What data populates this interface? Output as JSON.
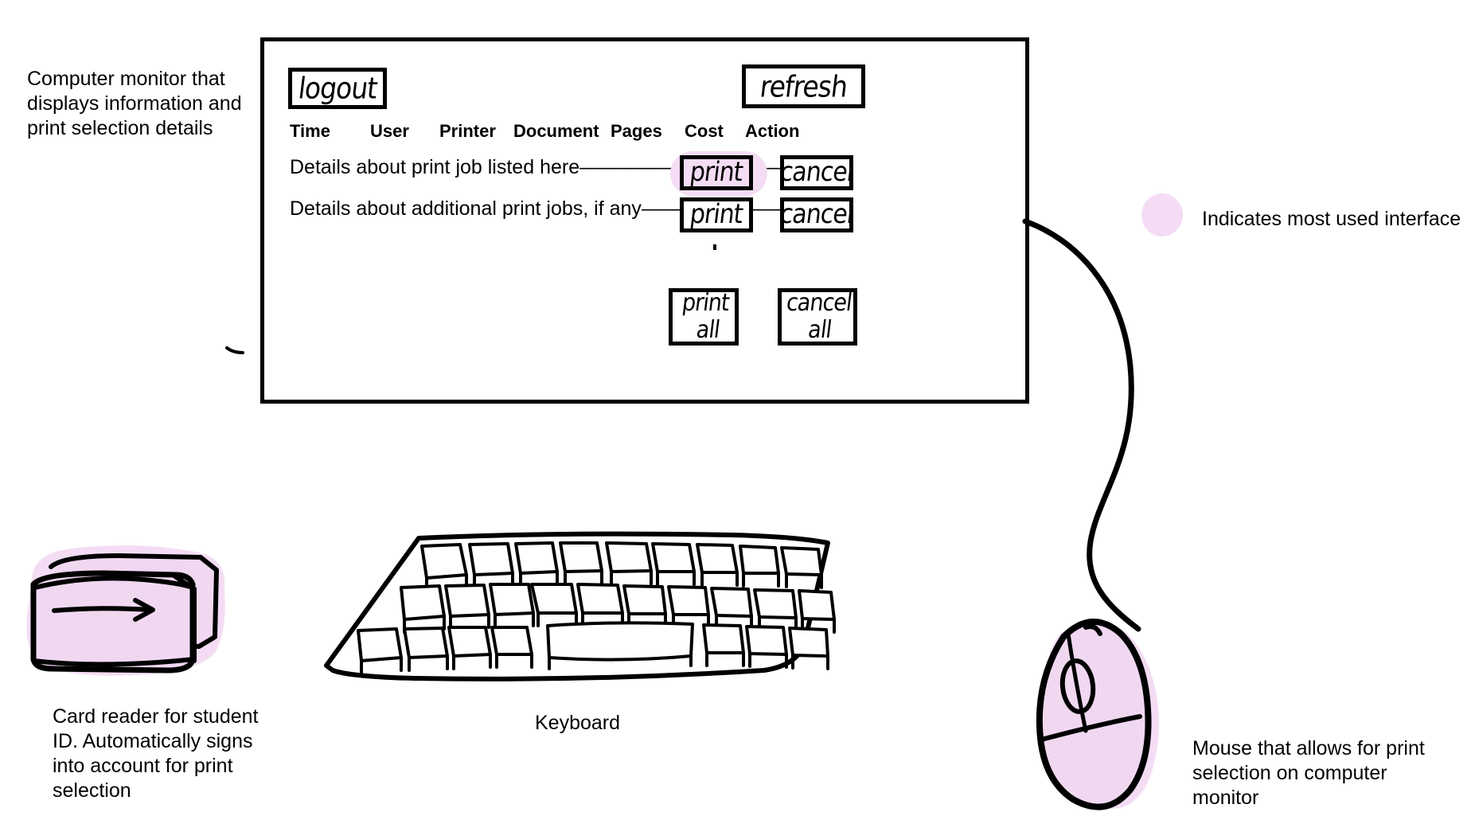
{
  "annotations": {
    "monitor": "Computer monitor that displays information and print selection details",
    "legend": "Indicates most used interface",
    "card_reader": "Card reader for student ID. Automatically signs into account for print selection",
    "keyboard": "Keyboard",
    "mouse": "Mouse that allows for print selection on computer monitor"
  },
  "colors": {
    "highlight": "#f4ddf4",
    "ink": "#000000",
    "background": "#ffffff"
  },
  "monitor": {
    "logout_label": "logout",
    "refresh_label": "refresh",
    "table": {
      "headers": [
        "Time",
        "User",
        "Printer",
        "Document",
        "Pages",
        "Cost",
        "Action"
      ],
      "rows": [
        {
          "text": "Details about print job listed here",
          "trailing": "————————————",
          "print_label": "print",
          "cancel_label": "cancel",
          "highlighted": true
        },
        {
          "text": "Details about additional print jobs, if any",
          "trailing": "————————",
          "print_label": "print",
          "cancel_label": "cancel",
          "highlighted": false
        }
      ]
    },
    "bulk_actions": {
      "print_all_line1": "print",
      "print_all_line2": "all",
      "cancel_all_line1": "cancel",
      "cancel_all_line2": "all"
    }
  },
  "devices": {
    "card_reader_name": "card-reader",
    "keyboard_name": "keyboard",
    "mouse_name": "mouse"
  }
}
